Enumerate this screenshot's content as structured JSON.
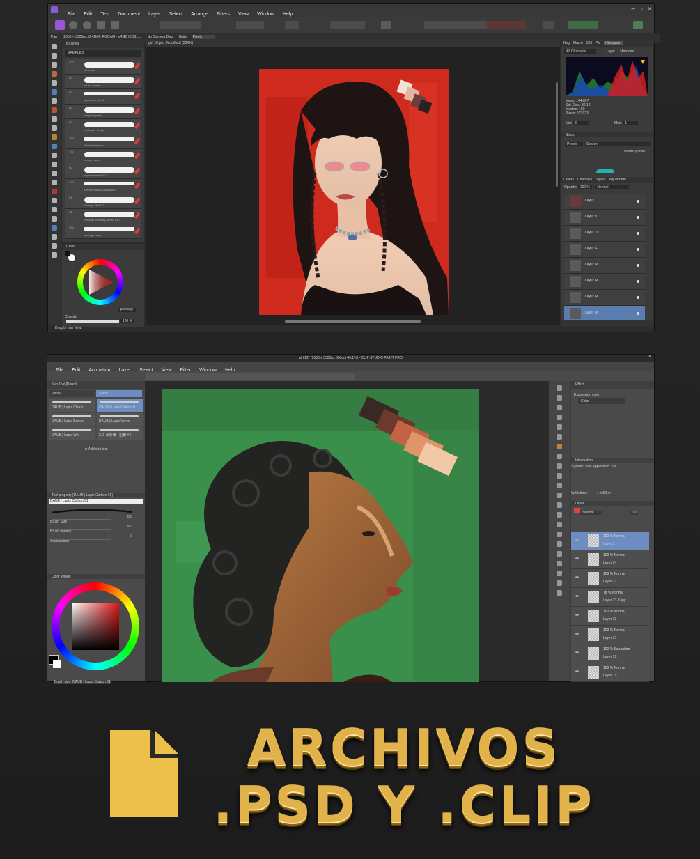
{
  "affinity": {
    "menu": [
      "File",
      "Edit",
      "Text",
      "Document",
      "Layer",
      "Select",
      "Arrange",
      "Filters",
      "View",
      "Window",
      "Help"
    ],
    "info_left": "Pan",
    "doc_info": "2550 × 3300px, 8.42MP, RGBA/8 - sRGB IEC61...",
    "camera": "No Camera Data",
    "units_label": "Units:",
    "units_value": "Pixels",
    "tab_title": "girl 18.psd (Modified) (234%)",
    "brushes": {
      "panel_title": "Brushes",
      "category": "SAMPLES",
      "items": [
        {
          "size": "100",
          "name": "Airbrush"
        },
        {
          "size": "90",
          "name": "round simple 1"
        },
        {
          "size": "90",
          "name": "square simple 3"
        },
        {
          "size": "90",
          "name": "simple square"
        },
        {
          "size": "90",
          "name": "rectangle simple"
        },
        {
          "size": "100",
          "name": "Airbrush eraser"
        },
        {
          "size": "231",
          "name": "eraser round"
        },
        {
          "size": "90",
          "name": "square simple 2.2"
        },
        {
          "size": "100",
          "name": "Dense Grainy Gouache 2"
        },
        {
          "size": "81",
          "name": "Grunge Oil 01 2"
        },
        {
          "size": "92",
          "name": "Smooth Blending Acrylic 01 2"
        },
        {
          "size": "100",
          "name": "smudge basic"
        }
      ]
    },
    "color_panel": {
      "title": "Color",
      "opacity_label": "Opacity",
      "opacity_value": "100 %",
      "hex": "FFFFFF"
    },
    "histogram": {
      "tabs": [
        "Nvg",
        "Macro",
        "32ft",
        "Pix",
        "Histogram"
      ],
      "channel": "All Channels",
      "layer_label": "Layer",
      "marquee_label": "Marquee",
      "stats": [
        "Mean: 144.097",
        "Std. Dev.: 80.12",
        "Median: 159",
        "Pixels: 523923"
      ],
      "min_label": "Min:",
      "min_value": "0",
      "max_label": "Max:",
      "max_value": "1"
    },
    "stock": {
      "title": "Stock",
      "source": "Pexels",
      "placeholder": "Search",
      "powered": "Powered by Pexels"
    },
    "layers": {
      "tabs": [
        "Layers",
        "Channels",
        "Styles",
        "Adjustment"
      ],
      "opacity_label": "Opacity:",
      "opacity": "100 %",
      "blend": "Normal",
      "items": [
        "Layer 1",
        "Layer 9",
        "Layer 70",
        "Layer 67",
        "Layer 69",
        "Layer 68",
        "Layer 66",
        "Layer 65"
      ]
    },
    "status": "Drag to pan view."
  },
  "csp": {
    "title": "girl 12* (2550 x 3300px 300dpi 44.1%) - CLIP STUDIO PAINT PRO",
    "menu": [
      "File",
      "Edit",
      "Animation",
      "Layer",
      "Select",
      "View",
      "Filter",
      "Window",
      "Help"
    ],
    "tabs": [
      "girl 12*",
      "girl 12*"
    ],
    "subtool": {
      "title": "Sub Tool [Pencil]",
      "tabs": [
        "Pencil",
        "LAPIZ"
      ],
      "items": [
        "DAUB | Lapis Classi",
        "DAUB | Lapis Carbon 0",
        "DAUB | Lapis Broken",
        "DAUB | Lapis Verve",
        "DAUB | Lapis Wet",
        "2.0: 水彩筆 - 鉛筆 #4"
      ],
      "add": "Add sub tool"
    },
    "toolprop": {
      "title": "Tool property [DAUB | Lapis Carbon 01]",
      "name": "DAUB | Lapis Carbon 01",
      "rows": [
        {
          "label": "Brush Size",
          "value": "8.0"
        },
        {
          "label": "Brush density",
          "value": "100"
        },
        {
          "label": "Stabilization",
          "value": "0"
        }
      ]
    },
    "colorwheel_title": "Color Wheel",
    "brushsize": {
      "title": "Brush size [DAUB | Lapis Carbon 01]",
      "values": [
        "0.7",
        "1",
        "1.5",
        "2",
        "2.5",
        "3",
        "4",
        "5"
      ]
    },
    "effect": {
      "title": "Effect",
      "label": "Expression color",
      "value": "Color",
      "tab": "Layer Pro"
    },
    "information": {
      "title": "Information",
      "system": "System: 38%",
      "application": "Application: 7%",
      "worktime_label": "Work time:",
      "worktime": "1 h 50 m"
    },
    "layer": {
      "title": "Layer",
      "blend": "Normal",
      "opacity": "100",
      "items": [
        {
          "mode": "100 % Normal",
          "name": "Layer 2"
        },
        {
          "mode": "100 % Normal",
          "name": "Layer 24"
        },
        {
          "mode": "100 % Normal",
          "name": "Layer 22"
        },
        {
          "mode": "78 % Normal",
          "name": "Layer 23 Copy"
        },
        {
          "mode": "100 % Normal",
          "name": "Layer 23"
        },
        {
          "mode": "100 % Normal",
          "name": "Layer 21"
        },
        {
          "mode": "100 % Saturation",
          "name": "Layer 20"
        },
        {
          "mode": "100 % Normal",
          "name": "Layer 19"
        }
      ]
    }
  },
  "banner": {
    "line1": "ARCHIVOS",
    "line2": ".PSD Y .CLIP",
    "icon": "document-icon",
    "gold": "#e2b24a"
  }
}
